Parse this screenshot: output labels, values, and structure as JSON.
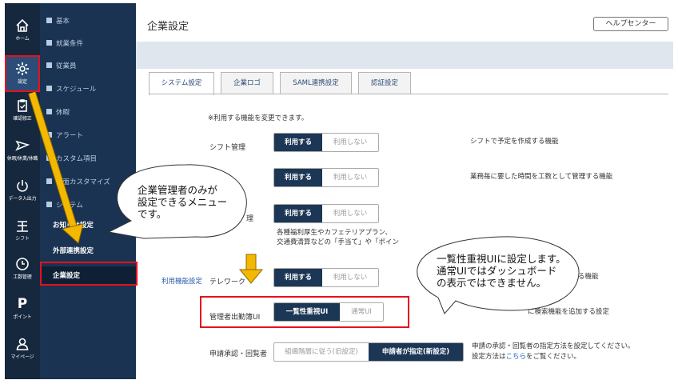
{
  "rail": [
    {
      "label": "ホーム",
      "icon": "home-icon"
    },
    {
      "label": "設定",
      "icon": "gear-icon"
    },
    {
      "label": "確認修正",
      "icon": "clipboard-icon"
    },
    {
      "label": "休暇/休業/休職",
      "icon": "plane-icon"
    },
    {
      "label": "データ入出力",
      "icon": "power-icon"
    },
    {
      "label": "シフト",
      "icon": "shift-icon"
    },
    {
      "label": "工数管理",
      "icon": "clock-icon"
    },
    {
      "label": "ポイント",
      "icon": "point-icon"
    },
    {
      "label": "マイページ",
      "icon": "user-icon"
    }
  ],
  "rail_points_glyph": "P",
  "menu": {
    "heads": [
      "基本",
      "就業条件",
      "従業員",
      "スケジュール",
      "休暇",
      "アラート",
      "カスタム項目",
      "画面カスタマイズ",
      "システム"
    ],
    "sub_notice": "お知らせ設定",
    "sub_external": "外部連携設定",
    "sub_company": "企業設定"
  },
  "header": {
    "title": "企業設定",
    "help_label": "ヘルプセンター"
  },
  "tabs": [
    "システム設定",
    "企業ロゴ",
    "SAML連携設定",
    "認証設定"
  ],
  "notice": "※利用する機能を変更できます。",
  "toggle_on_label": "利用する",
  "toggle_off_label": "利用しない",
  "rows": {
    "shift_label": "シフト管理",
    "shift_desc": "シフトで予定を作成する機能",
    "manhour_desc": "業務毎に要した時間を工数として管理する機能",
    "benefit_label_tail": "理",
    "benefit_desc_1": "各種福利厚生やカフェテリアプラン、",
    "benefit_desc_2": "交通費清算などの「手当て」や「ポイン",
    "telework_group": "利用機能設定",
    "telework_label": "テレワーク",
    "telework_desc": "化する機能",
    "admin_label": "管理者出勤簿UI",
    "admin_on": "一覧性重視UI",
    "admin_off": "通常UI",
    "admin_desc": "に検索機能を追加する設定",
    "approval_label": "申請承認・回覧者",
    "approval_off": "組織階層に従う(旧設定)",
    "approval_on": "申請者が指定(新設定)",
    "approval_desc_1": "申請の承認・回覧者の指定方法を設定してください。",
    "approval_desc_2_pre": "設定方法は",
    "approval_desc_2_link": "こちら",
    "approval_desc_2_post": "をご覧ください。"
  },
  "callouts": {
    "left": [
      "企業管理者のみが",
      "設定できるメニュー",
      "です。"
    ],
    "right": [
      "一覧性重視UIに設定します。",
      "通常UIではダッシュボード",
      "の表示ではできません。"
    ]
  },
  "colors": {
    "sidebar": "#16283e",
    "menu": "#1a3352",
    "accent": "#1c3655",
    "annotation_red": "#e8101c",
    "arrow_orange": "#f5b800"
  }
}
